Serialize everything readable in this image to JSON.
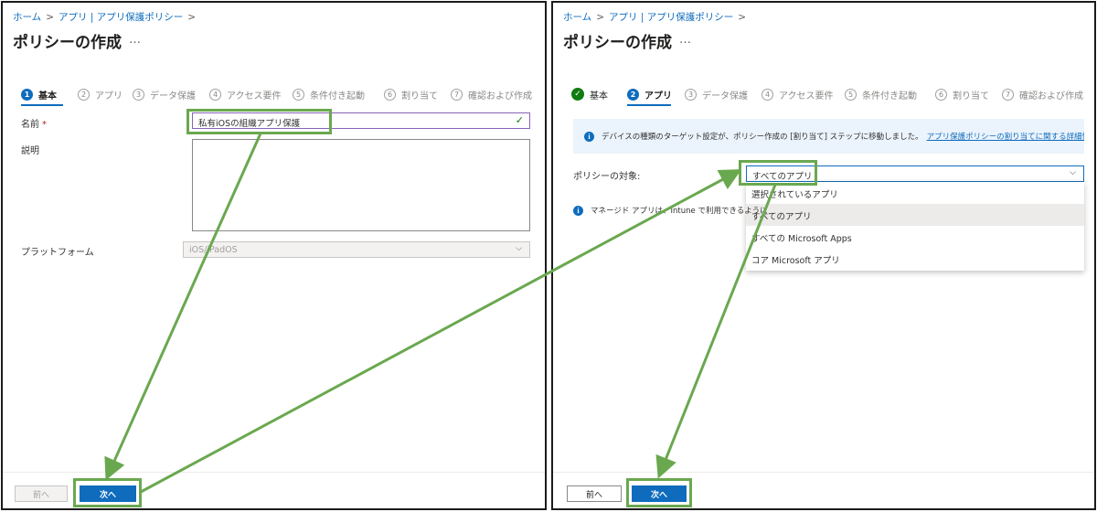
{
  "left": {
    "breadcrumb": [
      "ホーム",
      "アプリ | アプリ保護ポリシー"
    ],
    "title": "ポリシーの作成",
    "more": "…",
    "steps": [
      {
        "num": "1",
        "label": "基本"
      },
      {
        "num": "2",
        "label": "アプリ"
      },
      {
        "num": "3",
        "label": "データ保護"
      },
      {
        "num": "4",
        "label": "アクセス要件"
      },
      {
        "num": "5",
        "label": "条件付き起動"
      },
      {
        "num": "6",
        "label": "割り当て"
      },
      {
        "num": "7",
        "label": "確認および作成"
      }
    ],
    "name_label": "名前",
    "required_mark": "*",
    "name_value": "私有iOSの組織アプリ保護",
    "desc_label": "説明",
    "platform_label": "プラットフォーム",
    "platform_value": "iOS/iPadOS",
    "prev_label": "前へ",
    "next_label": "次へ"
  },
  "right": {
    "breadcrumb": [
      "ホーム",
      "アプリ | アプリ保護ポリシー"
    ],
    "title": "ポリシーの作成",
    "more": "…",
    "steps": [
      {
        "num": "✓",
        "label": "基本"
      },
      {
        "num": "2",
        "label": "アプリ"
      },
      {
        "num": "3",
        "label": "データ保護"
      },
      {
        "num": "4",
        "label": "アクセス要件"
      },
      {
        "num": "5",
        "label": "条件付き起動"
      },
      {
        "num": "6",
        "label": "割り当て"
      },
      {
        "num": "7",
        "label": "確認および作成"
      }
    ],
    "banner_text": "デバイスの種類のターゲット設定が、ポリシー作成の [割り当て] ステップに移動しました。",
    "banner_link": "アプリ保護ポリシーの割り当てに関する詳細情報",
    "target_label": "ポリシーの対象:",
    "target_value": "すべてのアプリ",
    "options": [
      "選択されているアプリ",
      "すべてのアプリ",
      "すべての Microsoft Apps",
      "コア Microsoft アプリ"
    ],
    "managed_text": "マネージド アプリは、Intune で利用できるように",
    "prev_label": "前へ",
    "next_label": "次へ"
  },
  "colors": {
    "accent": "#0f6cbd",
    "highlight": "#6aa84f",
    "success": "#107c10"
  }
}
